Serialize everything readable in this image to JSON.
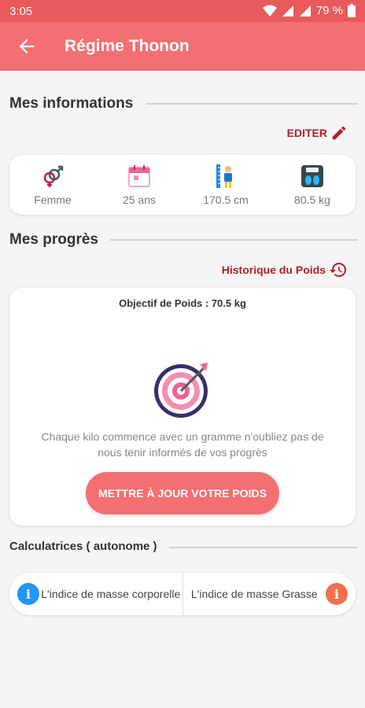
{
  "status_bar": {
    "time": "3:05",
    "battery": "79 %"
  },
  "app_bar": {
    "title": "Régime Thonon"
  },
  "info_section": {
    "title": "Mes informations",
    "edit_label": "EDITER",
    "items": [
      {
        "icon": "gender-icon",
        "label": "Femme"
      },
      {
        "icon": "calendar-icon",
        "label": "25 ans"
      },
      {
        "icon": "height-icon",
        "label": "170.5 cm"
      },
      {
        "icon": "scale-icon",
        "label": "80.5 kg"
      }
    ]
  },
  "progress_section": {
    "title": "Mes progrès",
    "history_label": "Historique du Poids",
    "goal": "Objectif de Poids : 70.5 kg",
    "motivation": "Chaque kilo commence avec un gramme n'oubliez pas de nous tenir informés de vos progrès",
    "update_button": "METTRE À JOUR VOTRE POIDS"
  },
  "calculators": {
    "title": "Calculatrices ( autonome )",
    "items": [
      {
        "label": "L'indice de masse corporelle",
        "icon": "info-icon",
        "color": "#2196f3"
      },
      {
        "label": "L'indice de masse Grasse",
        "icon": "info-icon",
        "color": "#f0704e"
      }
    ]
  },
  "colors": {
    "primary": "#f46f71",
    "status_bar": "#e85a5c",
    "accent_dark_red": "#b0202a"
  }
}
